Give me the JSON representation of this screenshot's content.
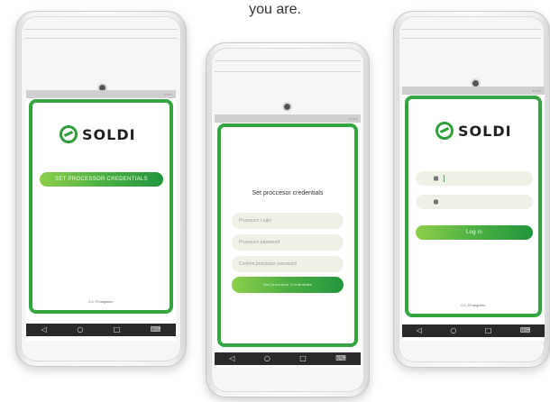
{
  "caption": "you are.",
  "phone1": {
    "brand": "SOLDI",
    "button_label": "SET PROCESSOR CREDENTIALS",
    "version": "0.1.79 aegistec"
  },
  "phone2": {
    "heading": "Set proccesor credentials",
    "login_placeholder": "Processor Login",
    "password_placeholder": "Processor password",
    "confirm_placeholder": "Confirm processor password",
    "button_label": "Set processor Credentials"
  },
  "phone3": {
    "brand": "SOLDI",
    "button_label": "Log in",
    "version": "0.1.79 aegistec"
  },
  "navbar_icons": [
    "back-icon",
    "home-icon",
    "recents-icon",
    "keyboard-icon"
  ],
  "colors": {
    "accent_green": "#33a541",
    "button_gradient_start": "#8ccf4a",
    "button_gradient_end": "#22953c",
    "navbar": "#2a2a2c",
    "field_bg": "#eef2e6"
  }
}
